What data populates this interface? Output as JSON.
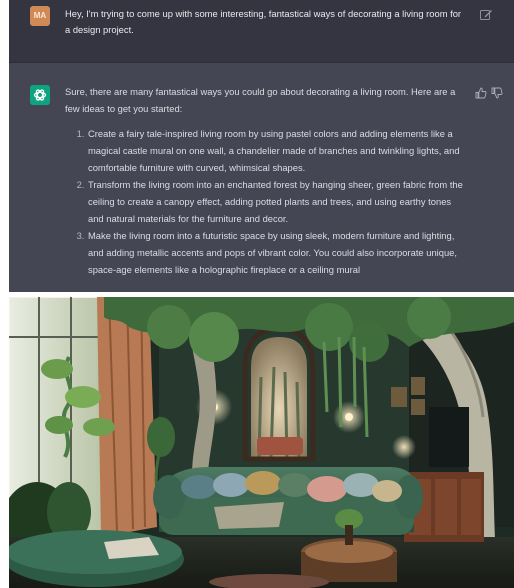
{
  "user_message": {
    "avatar_initials": "MA",
    "text": "Hey, I'm trying to come up with some interesting, fantastical ways of decorating a living room for a design project."
  },
  "assistant_message": {
    "intro": "Sure, there are many fantastical ways you could go about decorating a living room. Here are a few ideas to get you started:",
    "ideas": [
      "Create a fairy tale-inspired living room by using pastel colors and adding elements like a magical castle mural on one wall, a chandelier made of branches and twinkling lights, and comfortable furniture with curved, whimsical shapes.",
      "Transform the living room into an enchanted forest by hanging sheer, green fabric from the ceiling to create a canopy effect, adding potted plants and trees, and using earthy tones and natural materials for the furniture and decor.",
      "Make the living room into a futuristic space by using sleek, modern furniture and lighting, and adding metallic accents and pops of vibrant color. You could also incorporate unique, space-age elements like a holographic fireplace or a ceiling mural"
    ]
  },
  "icons": {
    "user_avatar": "user-avatar",
    "assistant_avatar": "openai-logo-icon",
    "edit": "edit-icon",
    "thumbs_up": "thumbs-up-icon",
    "thumbs_down": "thumbs-down-icon"
  },
  "colors": {
    "user_row_bg": "#343541",
    "assistant_row_bg": "#444654",
    "assistant_avatar": "#10a37f",
    "user_avatar": "#d18a55"
  },
  "image": {
    "subject": "forest-themed living room render"
  }
}
